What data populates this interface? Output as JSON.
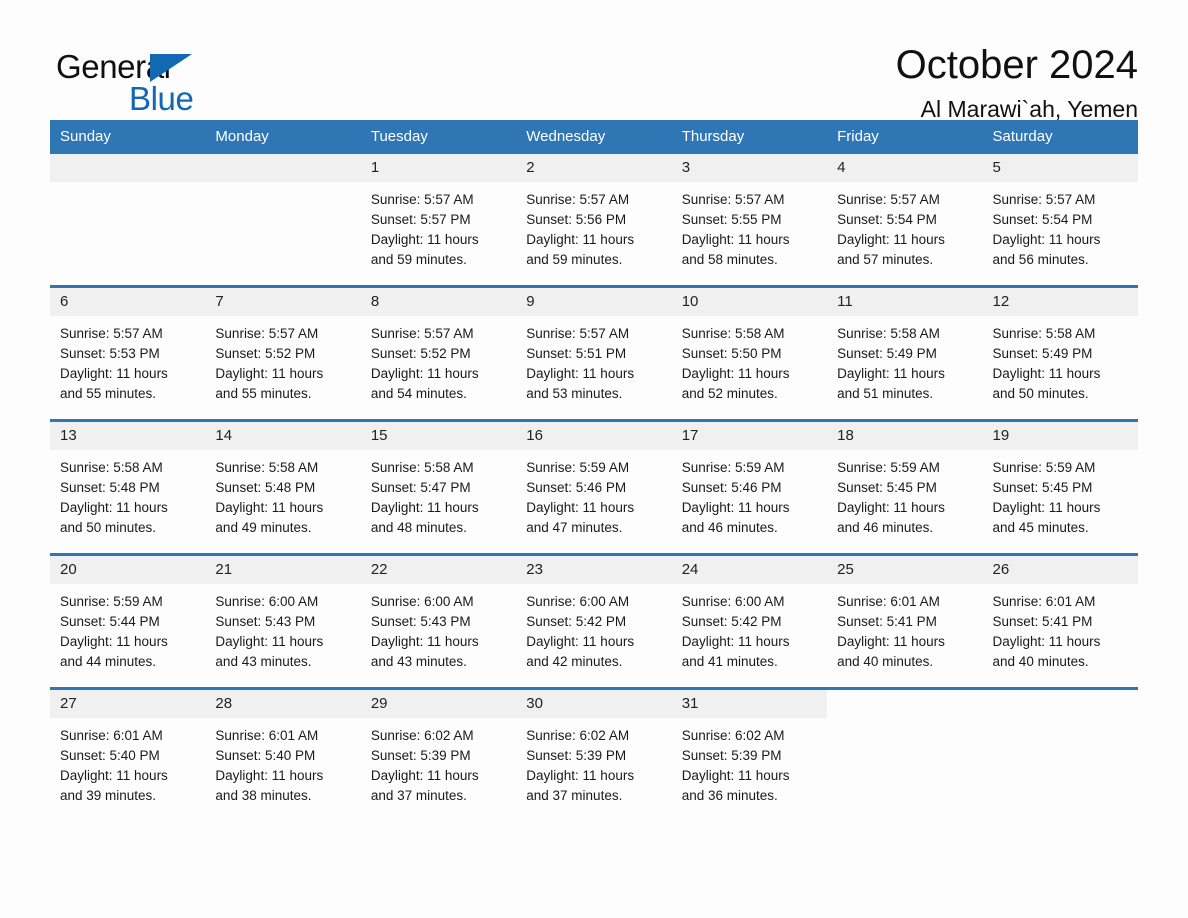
{
  "logo": {
    "word_one": "General",
    "word_two": "Blue",
    "accent_color": "#1268b3",
    "triangle_icon": "triangle-icon"
  },
  "header": {
    "month_title": "October 2024",
    "location": "Al Marawi`ah, Yemen"
  },
  "calendar": {
    "header_color": "#2f76b5",
    "daynum_band_color": "#f0f0f0",
    "columns": [
      "Sunday",
      "Monday",
      "Tuesday",
      "Wednesday",
      "Thursday",
      "Friday",
      "Saturday"
    ],
    "weeks": [
      [
        {
          "day": "",
          "lines": []
        },
        {
          "day": "",
          "lines": []
        },
        {
          "day": "1",
          "lines": [
            "Sunrise: 5:57 AM",
            "Sunset: 5:57 PM",
            "Daylight: 11 hours",
            "and 59 minutes."
          ]
        },
        {
          "day": "2",
          "lines": [
            "Sunrise: 5:57 AM",
            "Sunset: 5:56 PM",
            "Daylight: 11 hours",
            "and 59 minutes."
          ]
        },
        {
          "day": "3",
          "lines": [
            "Sunrise: 5:57 AM",
            "Sunset: 5:55 PM",
            "Daylight: 11 hours",
            "and 58 minutes."
          ]
        },
        {
          "day": "4",
          "lines": [
            "Sunrise: 5:57 AM",
            "Sunset: 5:54 PM",
            "Daylight: 11 hours",
            "and 57 minutes."
          ]
        },
        {
          "day": "5",
          "lines": [
            "Sunrise: 5:57 AM",
            "Sunset: 5:54 PM",
            "Daylight: 11 hours",
            "and 56 minutes."
          ]
        }
      ],
      [
        {
          "day": "6",
          "lines": [
            "Sunrise: 5:57 AM",
            "Sunset: 5:53 PM",
            "Daylight: 11 hours",
            "and 55 minutes."
          ]
        },
        {
          "day": "7",
          "lines": [
            "Sunrise: 5:57 AM",
            "Sunset: 5:52 PM",
            "Daylight: 11 hours",
            "and 55 minutes."
          ]
        },
        {
          "day": "8",
          "lines": [
            "Sunrise: 5:57 AM",
            "Sunset: 5:52 PM",
            "Daylight: 11 hours",
            "and 54 minutes."
          ]
        },
        {
          "day": "9",
          "lines": [
            "Sunrise: 5:57 AM",
            "Sunset: 5:51 PM",
            "Daylight: 11 hours",
            "and 53 minutes."
          ]
        },
        {
          "day": "10",
          "lines": [
            "Sunrise: 5:58 AM",
            "Sunset: 5:50 PM",
            "Daylight: 11 hours",
            "and 52 minutes."
          ]
        },
        {
          "day": "11",
          "lines": [
            "Sunrise: 5:58 AM",
            "Sunset: 5:49 PM",
            "Daylight: 11 hours",
            "and 51 minutes."
          ]
        },
        {
          "day": "12",
          "lines": [
            "Sunrise: 5:58 AM",
            "Sunset: 5:49 PM",
            "Daylight: 11 hours",
            "and 50 minutes."
          ]
        }
      ],
      [
        {
          "day": "13",
          "lines": [
            "Sunrise: 5:58 AM",
            "Sunset: 5:48 PM",
            "Daylight: 11 hours",
            "and 50 minutes."
          ]
        },
        {
          "day": "14",
          "lines": [
            "Sunrise: 5:58 AM",
            "Sunset: 5:48 PM",
            "Daylight: 11 hours",
            "and 49 minutes."
          ]
        },
        {
          "day": "15",
          "lines": [
            "Sunrise: 5:58 AM",
            "Sunset: 5:47 PM",
            "Daylight: 11 hours",
            "and 48 minutes."
          ]
        },
        {
          "day": "16",
          "lines": [
            "Sunrise: 5:59 AM",
            "Sunset: 5:46 PM",
            "Daylight: 11 hours",
            "and 47 minutes."
          ]
        },
        {
          "day": "17",
          "lines": [
            "Sunrise: 5:59 AM",
            "Sunset: 5:46 PM",
            "Daylight: 11 hours",
            "and 46 minutes."
          ]
        },
        {
          "day": "18",
          "lines": [
            "Sunrise: 5:59 AM",
            "Sunset: 5:45 PM",
            "Daylight: 11 hours",
            "and 46 minutes."
          ]
        },
        {
          "day": "19",
          "lines": [
            "Sunrise: 5:59 AM",
            "Sunset: 5:45 PM",
            "Daylight: 11 hours",
            "and 45 minutes."
          ]
        }
      ],
      [
        {
          "day": "20",
          "lines": [
            "Sunrise: 5:59 AM",
            "Sunset: 5:44 PM",
            "Daylight: 11 hours",
            "and 44 minutes."
          ]
        },
        {
          "day": "21",
          "lines": [
            "Sunrise: 6:00 AM",
            "Sunset: 5:43 PM",
            "Daylight: 11 hours",
            "and 43 minutes."
          ]
        },
        {
          "day": "22",
          "lines": [
            "Sunrise: 6:00 AM",
            "Sunset: 5:43 PM",
            "Daylight: 11 hours",
            "and 43 minutes."
          ]
        },
        {
          "day": "23",
          "lines": [
            "Sunrise: 6:00 AM",
            "Sunset: 5:42 PM",
            "Daylight: 11 hours",
            "and 42 minutes."
          ]
        },
        {
          "day": "24",
          "lines": [
            "Sunrise: 6:00 AM",
            "Sunset: 5:42 PM",
            "Daylight: 11 hours",
            "and 41 minutes."
          ]
        },
        {
          "day": "25",
          "lines": [
            "Sunrise: 6:01 AM",
            "Sunset: 5:41 PM",
            "Daylight: 11 hours",
            "and 40 minutes."
          ]
        },
        {
          "day": "26",
          "lines": [
            "Sunrise: 6:01 AM",
            "Sunset: 5:41 PM",
            "Daylight: 11 hours",
            "and 40 minutes."
          ]
        }
      ],
      [
        {
          "day": "27",
          "lines": [
            "Sunrise: 6:01 AM",
            "Sunset: 5:40 PM",
            "Daylight: 11 hours",
            "and 39 minutes."
          ]
        },
        {
          "day": "28",
          "lines": [
            "Sunrise: 6:01 AM",
            "Sunset: 5:40 PM",
            "Daylight: 11 hours",
            "and 38 minutes."
          ]
        },
        {
          "day": "29",
          "lines": [
            "Sunrise: 6:02 AM",
            "Sunset: 5:39 PM",
            "Daylight: 11 hours",
            "and 37 minutes."
          ]
        },
        {
          "day": "30",
          "lines": [
            "Sunrise: 6:02 AM",
            "Sunset: 5:39 PM",
            "Daylight: 11 hours",
            "and 37 minutes."
          ]
        },
        {
          "day": "31",
          "lines": [
            "Sunrise: 6:02 AM",
            "Sunset: 5:39 PM",
            "Daylight: 11 hours",
            "and 36 minutes."
          ]
        },
        {
          "day": "",
          "lines": []
        },
        {
          "day": "",
          "lines": []
        }
      ]
    ]
  }
}
